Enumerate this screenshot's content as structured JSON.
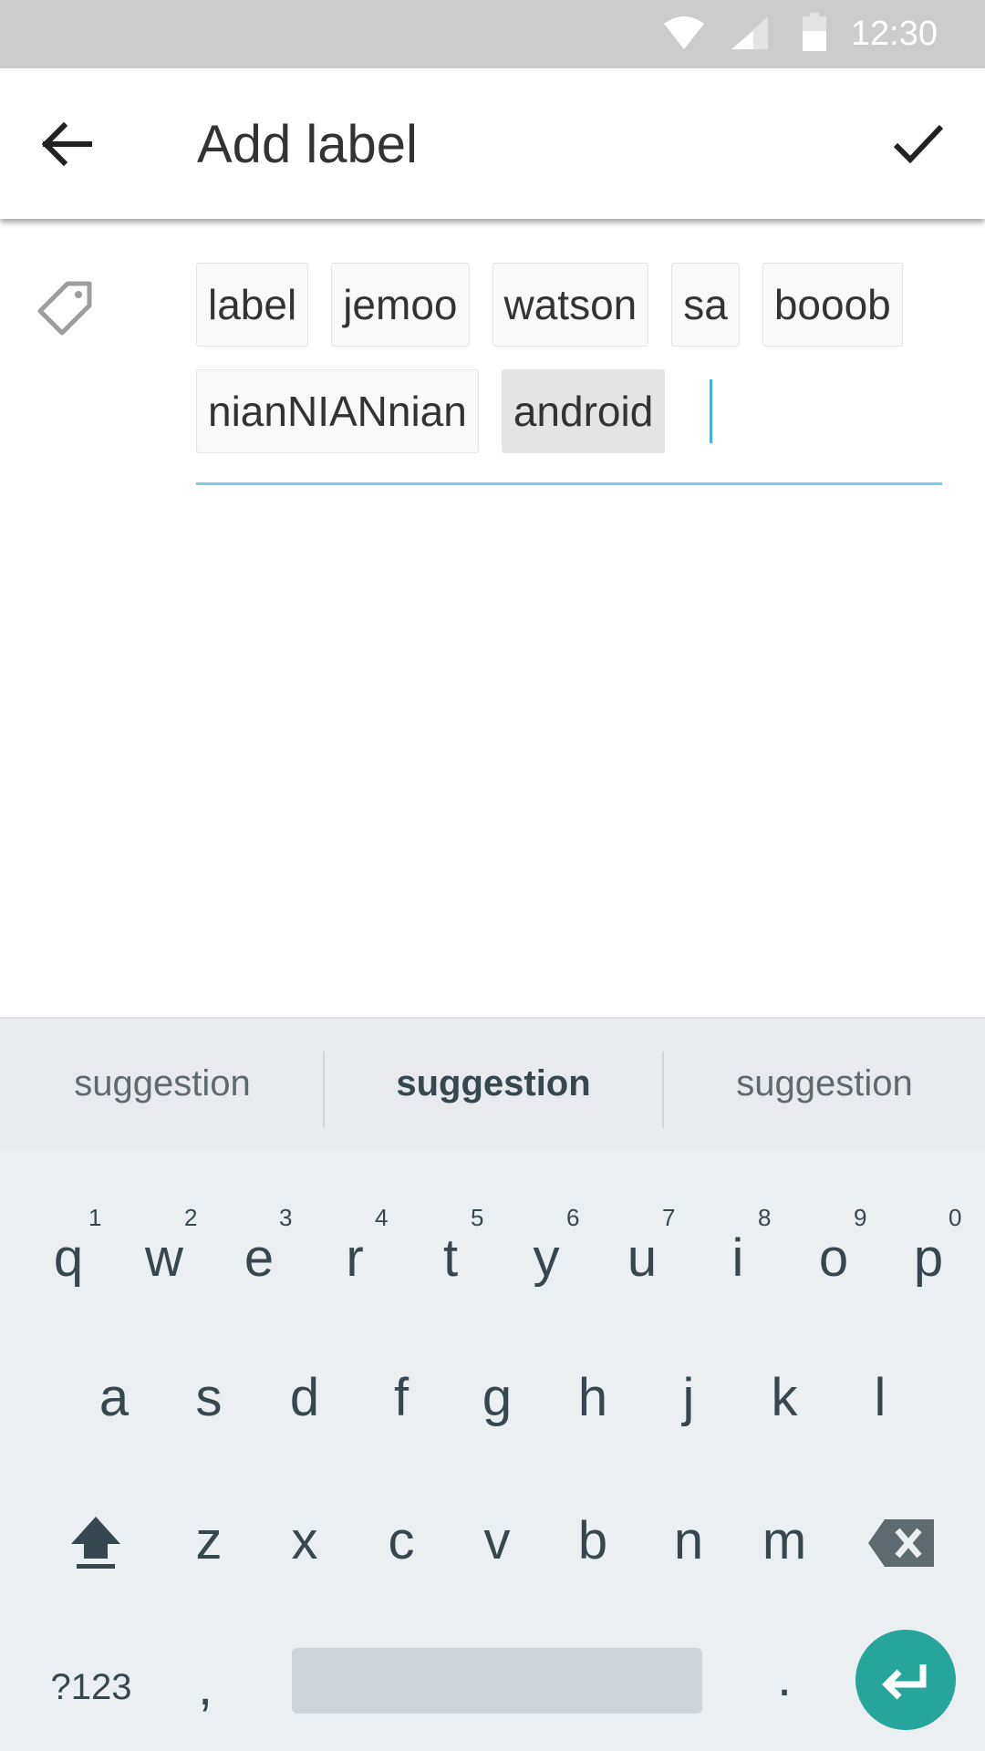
{
  "status_bar": {
    "time": "12:30",
    "icons": [
      "wifi-icon",
      "cell-signal-icon",
      "battery-icon"
    ]
  },
  "toolbar": {
    "title": "Add label",
    "back_icon": "back-arrow-icon",
    "confirm_icon": "check-icon"
  },
  "labels": {
    "icon": "label-tag-icon",
    "chips": [
      {
        "text": "label",
        "selected": false
      },
      {
        "text": "jemoo",
        "selected": false
      },
      {
        "text": "watson",
        "selected": false
      },
      {
        "text": "sa",
        "selected": false
      },
      {
        "text": "booob",
        "selected": false
      },
      {
        "text": "nianNIANnian",
        "selected": false
      },
      {
        "text": "android",
        "selected": true
      }
    ],
    "input_value": ""
  },
  "keyboard": {
    "suggestions": [
      "suggestion",
      "suggestion",
      "suggestion"
    ],
    "row1": [
      "q",
      "w",
      "e",
      "r",
      "t",
      "y",
      "u",
      "i",
      "o",
      "p"
    ],
    "row1_numbers": [
      "1",
      "2",
      "3",
      "4",
      "5",
      "6",
      "7",
      "8",
      "9",
      "0"
    ],
    "row2": [
      "a",
      "s",
      "d",
      "f",
      "g",
      "h",
      "j",
      "k",
      "l"
    ],
    "row3": [
      "z",
      "x",
      "c",
      "v",
      "b",
      "n",
      "m"
    ],
    "symbols_label": "?123",
    "comma": ",",
    "period": ".",
    "colors": {
      "background": "#eceff1",
      "accent": "#26a69a",
      "key_text": "#37474f"
    }
  }
}
